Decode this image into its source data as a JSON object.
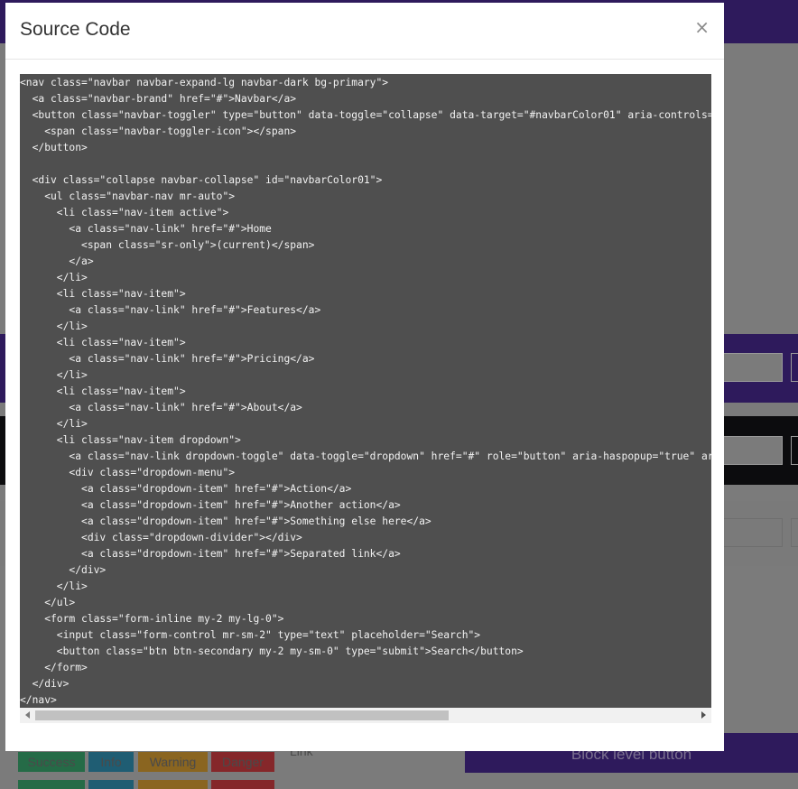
{
  "modal": {
    "title": "Source Code",
    "close_icon": "×",
    "code_lines": [
      "<nav class=\"navbar navbar-expand-lg navbar-dark bg-primary\">",
      "  <a class=\"navbar-brand\" href=\"#\">Navbar</a>",
      "  <button class=\"navbar-toggler\" type=\"button\" data-toggle=\"collapse\" data-target=\"#navbarColor01\" aria-controls=\"",
      "    <span class=\"navbar-toggler-icon\"></span>",
      "  </button>",
      "",
      "  <div class=\"collapse navbar-collapse\" id=\"navbarColor01\">",
      "    <ul class=\"navbar-nav mr-auto\">",
      "      <li class=\"nav-item active\">",
      "        <a class=\"nav-link\" href=\"#\">Home",
      "          <span class=\"sr-only\">(current)</span>",
      "        </a>",
      "      </li>",
      "      <li class=\"nav-item\">",
      "        <a class=\"nav-link\" href=\"#\">Features</a>",
      "      </li>",
      "      <li class=\"nav-item\">",
      "        <a class=\"nav-link\" href=\"#\">Pricing</a>",
      "      </li>",
      "      <li class=\"nav-item\">",
      "        <a class=\"nav-link\" href=\"#\">About</a>",
      "      </li>",
      "      <li class=\"nav-item dropdown\">",
      "        <a class=\"nav-link dropdown-toggle\" data-toggle=\"dropdown\" href=\"#\" role=\"button\" aria-haspopup=\"true\" ari",
      "        <div class=\"dropdown-menu\">",
      "          <a class=\"dropdown-item\" href=\"#\">Action</a>",
      "          <a class=\"dropdown-item\" href=\"#\">Another action</a>",
      "          <a class=\"dropdown-item\" href=\"#\">Something else here</a>",
      "          <div class=\"dropdown-divider\"></div>",
      "          <a class=\"dropdown-item\" href=\"#\">Separated link</a>",
      "        </div>",
      "      </li>",
      "    </ul>",
      "    <form class=\"form-inline my-2 my-lg-0\">",
      "      <input class=\"form-control mr-sm-2\" type=\"text\" placeholder=\"Search\">",
      "      <button class=\"btn btn-secondary my-2 my-sm-0\" type=\"submit\">Search</button>",
      "    </form>",
      "  </div>",
      "</nav>"
    ],
    "scroll_fraction_visible": 0.6
  },
  "background": {
    "buttons": [
      "Success",
      "Info",
      "Warning",
      "Danger"
    ],
    "link_label": "Link",
    "block_button_label": "Block level button"
  },
  "colors": {
    "overlay": "#7b7b7b",
    "primary": "#2e1a5c",
    "code_bg": "#4f4f4f",
    "code_text": "#f2f2f2"
  }
}
